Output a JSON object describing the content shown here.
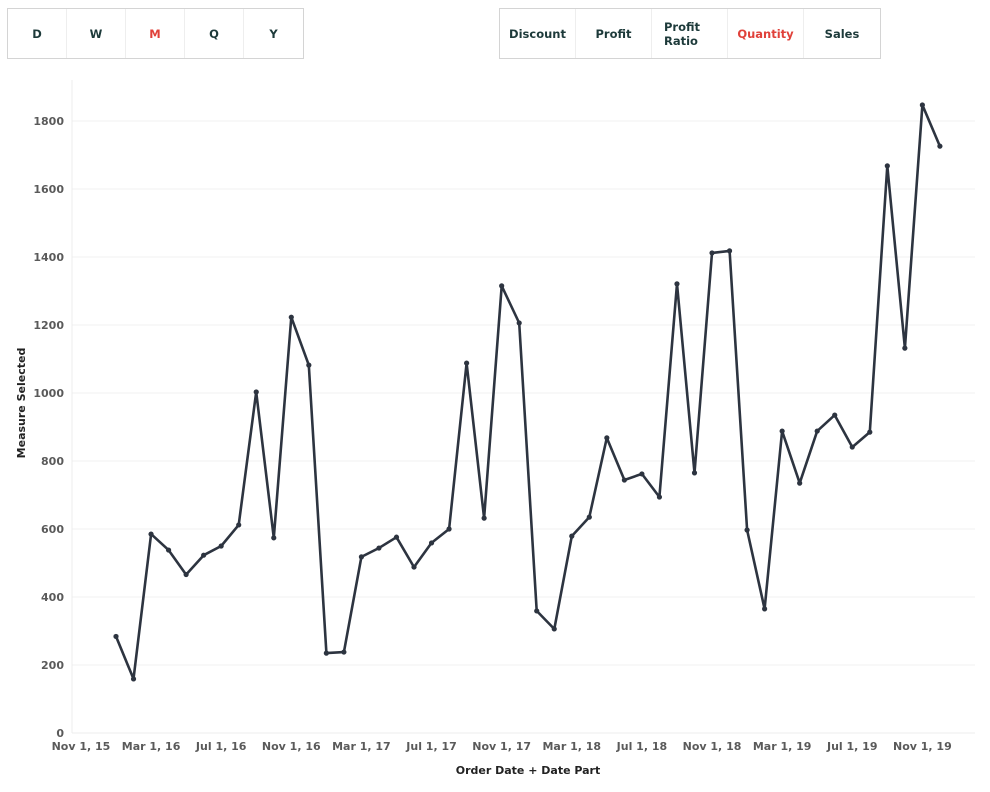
{
  "controls": {
    "date_part_buttons": [
      {
        "label": "D",
        "active": false
      },
      {
        "label": "W",
        "active": false
      },
      {
        "label": "M",
        "active": true
      },
      {
        "label": "Q",
        "active": false
      },
      {
        "label": "Y",
        "active": false
      }
    ],
    "measure_buttons": [
      {
        "label": "Discount",
        "active": false
      },
      {
        "label": "Profit",
        "active": false
      },
      {
        "label": "Profit Ratio",
        "active": false
      },
      {
        "label": "Quantity",
        "active": true
      },
      {
        "label": "Sales",
        "active": false
      }
    ]
  },
  "colors": {
    "line": "#2d3440",
    "active_button": "#e0413a",
    "button_text": "#1d3a3a",
    "gridline": "#f0f0f0"
  },
  "chart_data": {
    "type": "line",
    "title": "",
    "xlabel": "Order Date + Date Part",
    "ylabel": "Measure Selected",
    "ylim": [
      0,
      1900
    ],
    "yticks": [
      0,
      200,
      400,
      600,
      800,
      1000,
      1200,
      1400,
      1600,
      1800
    ],
    "grid": true,
    "x_range_months": [
      "2015-11",
      "2020-01"
    ],
    "xtick_labels": [
      {
        "label": "Nov 1, 15",
        "month": "2015-11"
      },
      {
        "label": "Mar 1, 16",
        "month": "2016-03"
      },
      {
        "label": "Jul 1, 16",
        "month": "2016-07"
      },
      {
        "label": "Nov 1, 16",
        "month": "2016-11"
      },
      {
        "label": "Mar 1, 17",
        "month": "2017-03"
      },
      {
        "label": "Jul 1, 17",
        "month": "2017-07"
      },
      {
        "label": "Nov 1, 17",
        "month": "2017-11"
      },
      {
        "label": "Mar 1, 18",
        "month": "2018-03"
      },
      {
        "label": "Jul 1, 18",
        "month": "2018-07"
      },
      {
        "label": "Nov 1, 18",
        "month": "2018-11"
      },
      {
        "label": "Mar 1, 19",
        "month": "2019-03"
      },
      {
        "label": "Jul 1, 19",
        "month": "2019-07"
      },
      {
        "label": "Nov 1, 19",
        "month": "2019-11"
      }
    ],
    "series": [
      {
        "name": "Quantity",
        "x": [
          "2016-01",
          "2016-02",
          "2016-03",
          "2016-04",
          "2016-05",
          "2016-06",
          "2016-07",
          "2016-08",
          "2016-09",
          "2016-10",
          "2016-11",
          "2016-12",
          "2017-01",
          "2017-02",
          "2017-03",
          "2017-04",
          "2017-05",
          "2017-06",
          "2017-07",
          "2017-08",
          "2017-09",
          "2017-10",
          "2017-11",
          "2017-12",
          "2018-01",
          "2018-02",
          "2018-03",
          "2018-04",
          "2018-05",
          "2018-06",
          "2018-07",
          "2018-08",
          "2018-09",
          "2018-10",
          "2018-11",
          "2018-12",
          "2019-01",
          "2019-02",
          "2019-03",
          "2019-04",
          "2019-05",
          "2019-06",
          "2019-07",
          "2019-08",
          "2019-09",
          "2019-10",
          "2019-11",
          "2019-12"
        ],
        "values": [
          284,
          159,
          585,
          538,
          466,
          523,
          550,
          612,
          1003,
          574,
          1223,
          1082,
          235,
          238,
          518,
          544,
          576,
          488,
          559,
          600,
          1088,
          632,
          1315,
          1206,
          359,
          306,
          579,
          635,
          868,
          744,
          762,
          694,
          1321,
          765,
          1412,
          1418,
          597,
          365,
          888,
          735,
          888,
          935,
          841,
          885,
          1668,
          1132,
          1847,
          1726
        ]
      }
    ]
  }
}
